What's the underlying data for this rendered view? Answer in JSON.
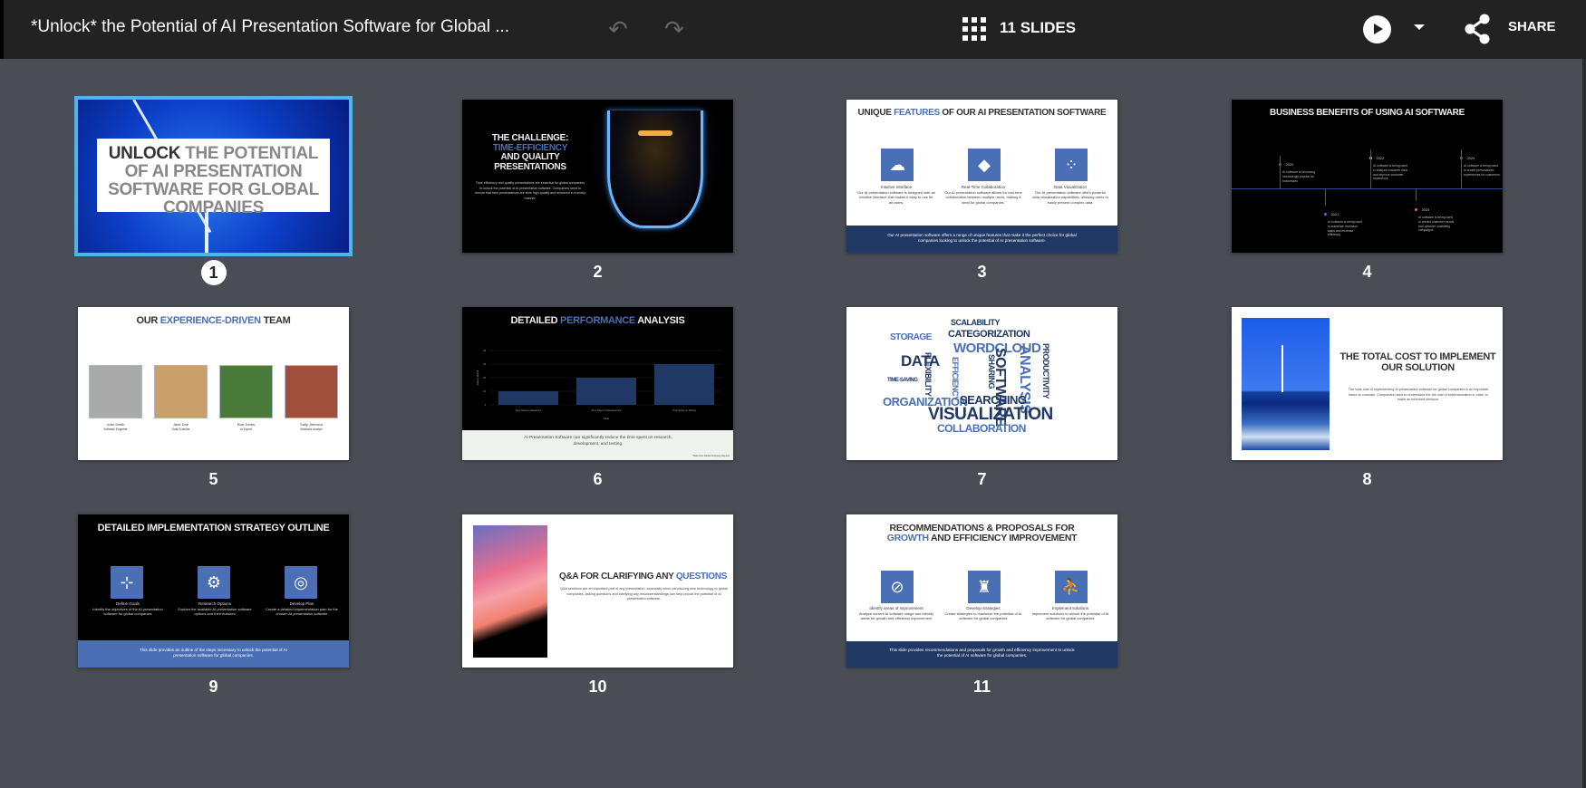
{
  "header": {
    "title": "*Unlock* the Potential of AI Presentation Software for Global ...",
    "slides_count": "11 SLIDES",
    "share": "SHARE",
    "undo_icon": "undo-icon",
    "redo_icon": "redo-icon"
  },
  "colors": {
    "accent": "#4db6e6",
    "brand_blue": "#4a6fb5",
    "navy": "#1f3864",
    "bg": "#4a4d54",
    "topbar": "#222222"
  },
  "selected_slide": 1,
  "slides": [
    {
      "number": "1",
      "title_a": "UNLOCK",
      "title_b": " THE POTENTIAL OF AI PRESENTATION SOFTWARE FOR GLOBAL COMPANIES"
    },
    {
      "number": "2",
      "title_a": "THE CHALLENGE:",
      "title_b": "TIME-EFFICIENCY",
      "title_c": "AND QUALITY PRESENTATIONS",
      "body": "Time efficiency and quality presentations are essential for global companies to unlock the potential of AI presentation software. Companies need to ensure that their presentations are both high-quality and delivered in a timely manner."
    },
    {
      "number": "3",
      "title_a": "UNIQUE ",
      "title_b": "FEATURES",
      "title_c": " OF OUR AI PRESENTATION SOFTWARE",
      "items": [
        {
          "name": "Intuitive Interface",
          "text": "Our AI presentation software is designed with an intuitive interface that makes it easy to use for all users."
        },
        {
          "name": "Real-Time Collaboration",
          "text": "Our AI presentation software allows for real-time collaboration between multiple users, making it ideal for global companies."
        },
        {
          "name": "Data Visualization",
          "text": "Our AI presentation software offers powerful data visualization capabilities, allowing users to easily present complex data."
        }
      ],
      "footer": "Our AI presentation software offers a range of unique features that make it the perfect choice for global companies looking to unlock the potential of AI presentation software."
    },
    {
      "number": "4",
      "title": "BUSINESS BENEFITS OF USING AI SOFTWARE",
      "events": [
        {
          "year": "2020",
          "text": "AI software is becoming increasingly popular for businesses",
          "color": "#4a6fb5"
        },
        {
          "year": "2021",
          "text": "AI software is being used to automate mundane tasks and increase efficiency",
          "color": "#4a6fb5"
        },
        {
          "year": "2022",
          "text": "AI software is being used to analyze customer data and improve customer experience",
          "color": "#8fd3c7"
        },
        {
          "year": "2023",
          "text": "AI software is being used to predict customer trends and optimize marketing campaigns",
          "color": "#e8663d"
        },
        {
          "year": "2024",
          "text": "AI software is being used to create personalized experiences for customers",
          "color": "#4a6fb5"
        }
      ]
    },
    {
      "number": "5",
      "title_a": "OUR ",
      "title_b": "EXPERIENCE-DRIVEN",
      "title_c": " TEAM",
      "members": [
        {
          "name": "John Smith",
          "role": "Software Engineer"
        },
        {
          "name": "Jane Doe",
          "role": "Data Scientist"
        },
        {
          "name": "Bob Jones",
          "role": "AI Expert"
        },
        {
          "name": "Sally Johnson",
          "role": "Business Analyst"
        }
      ]
    },
    {
      "number": "6",
      "title_a": "DETAILED ",
      "title_b": "PERFORMANCE",
      "title_c": " ANALYSIS",
      "chart": {
        "type": "bar",
        "categories": [
          "Time Spent on Research",
          "Time Spent on Development",
          "Time Spent on Testing"
        ],
        "values": [
          10,
          20,
          30
        ],
        "ylim": [
          0,
          40
        ],
        "yticks": [
          "0",
          "10",
          "20",
          "30",
          "40"
        ],
        "xlabel": "Task",
        "ylabel": "Hours Spent"
      },
      "footer": "AI Presentation Software can significantly reduce the time spent on research, development, and testing.",
      "note": "*Data from Global Company Reports"
    },
    {
      "number": "7",
      "words": [
        "STORAGE",
        "SCALABILITY",
        "CATEGORIZATION",
        "WORDCLOUD",
        "DATA",
        "FLEXIBILITY",
        "EFFICIENCY",
        "SHARING",
        "SOFTWARE",
        "ANALYSIS",
        "PRODUCTIVITY",
        "TIME-SAVING",
        "ORGANIZATION",
        "SEARCHING",
        "VISUALIZATION",
        "COLLABORATION"
      ]
    },
    {
      "number": "8",
      "title": "THE TOTAL COST TO IMPLEMENT OUR SOLUTION",
      "body": "The total cost of implementing AI presentation software for global companies is an important factor to consider. Companies need to understand the full cost of implementation in order to make an informed decision."
    },
    {
      "number": "9",
      "title": "DETAILED IMPLEMENTATION STRATEGY OUTLINE",
      "items": [
        {
          "name": "Define Goals",
          "text": "Identify the objectives of the AI presentation software for global companies"
        },
        {
          "name": "Research Options",
          "text": "Explore the available AI presentation software options and their features"
        },
        {
          "name": "Develop Plan",
          "text": "Create a detailed implementation plan for the chosen AI presentation software"
        }
      ],
      "footer": "This slide provides an outline of the steps necessary to unlock the potential of AI presentation software for global companies."
    },
    {
      "number": "10",
      "title_a": "Q&A FOR CLARIFYING ANY ",
      "title_b": "QUESTIONS",
      "body": "Q&A sessions are an important part of any presentation, especially when introducing new technology to global companies. Asking questions and clarifying any misunderstandings can help unlock the potential of AI presentation software."
    },
    {
      "number": "11",
      "title_a": "RECOMMENDATIONS & PROPOSALS FOR",
      "title_b": "GROWTH",
      "title_c": " AND EFFICIENCY IMPROVEMENT",
      "items": [
        {
          "name": "Identify areas of improvement",
          "text": "Analyze current AI software usage and identify areas for growth and efficiency improvement"
        },
        {
          "name": "Develop strategies",
          "text": "Create strategies to maximize the potential of AI software for global companies"
        },
        {
          "name": "Implement solutions",
          "text": "Implement solutions to unlock the potential of AI software for global companies"
        }
      ],
      "footer": "This slide provides recommendations and proposals for growth and efficiency improvement to unlock the potential of AI software for global companies."
    }
  ]
}
